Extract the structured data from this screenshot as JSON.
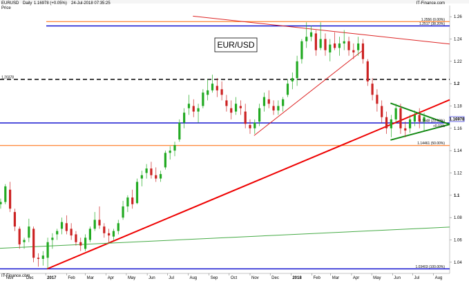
{
  "header": {
    "symbol": "EURUSD",
    "period": "Daily",
    "quote": "1.16978 (+0.05%)",
    "datetime": "24-Jul-2018 07:35:25",
    "source": "IT-Finance.com",
    "price_label": "Price"
  },
  "footer_source": "IT-Finance.com",
  "chart_data": {
    "type": "candlestick",
    "title": "EUR/USD",
    "ylim": [
      1.03,
      1.27
    ],
    "y_ticks": [
      {
        "value": 1.26,
        "label": "1.26",
        "bold": false
      },
      {
        "value": 1.24,
        "label": "1.24",
        "bold": false
      },
      {
        "value": 1.22,
        "label": "1.22",
        "bold": false
      },
      {
        "value": 1.2,
        "label": "1.2",
        "bold": true
      },
      {
        "value": 1.18,
        "label": "1.18",
        "bold": false
      },
      {
        "value": 1.16,
        "label": "1.16",
        "bold": false
      },
      {
        "value": 1.14,
        "label": "1.14",
        "bold": false
      },
      {
        "value": 1.12,
        "label": "1.12",
        "bold": false
      },
      {
        "value": 1.1,
        "label": "1.1",
        "bold": true
      },
      {
        "value": 1.08,
        "label": "1.08",
        "bold": false
      },
      {
        "value": 1.06,
        "label": "1.06",
        "bold": false
      },
      {
        "value": 1.04,
        "label": "1.04",
        "bold": false
      }
    ],
    "x_labels": [
      {
        "date": "2016-11-01",
        "label": "Nov",
        "bold": false
      },
      {
        "date": "2016-12-01",
        "label": "Dec",
        "bold": false
      },
      {
        "date": "2017-01-01",
        "label": "2017",
        "bold": true
      },
      {
        "date": "2017-02-01",
        "label": "Feb",
        "bold": false
      },
      {
        "date": "2017-03-01",
        "label": "Mar",
        "bold": false
      },
      {
        "date": "2017-04-01",
        "label": "Apr",
        "bold": false
      },
      {
        "date": "2017-05-01",
        "label": "May",
        "bold": false
      },
      {
        "date": "2017-06-01",
        "label": "Jun",
        "bold": false
      },
      {
        "date": "2017-07-01",
        "label": "Jul",
        "bold": false
      },
      {
        "date": "2017-08-01",
        "label": "Aug",
        "bold": false
      },
      {
        "date": "2017-09-01",
        "label": "Sep",
        "bold": false
      },
      {
        "date": "2017-10-01",
        "label": "Oct",
        "bold": false
      },
      {
        "date": "2017-11-01",
        "label": "Nov",
        "bold": false
      },
      {
        "date": "2017-12-01",
        "label": "Dec",
        "bold": false
      },
      {
        "date": "2018-01-01",
        "label": "2018",
        "bold": true
      },
      {
        "date": "2018-02-01",
        "label": "Feb",
        "bold": false
      },
      {
        "date": "2018-03-01",
        "label": "Mar",
        "bold": false
      },
      {
        "date": "2018-04-01",
        "label": "Apr",
        "bold": false
      },
      {
        "date": "2018-05-01",
        "label": "May",
        "bold": false
      },
      {
        "date": "2018-06-01",
        "label": "Jun",
        "bold": false
      },
      {
        "date": "2018-07-01",
        "label": "Jul",
        "bold": false
      },
      {
        "date": "2018-08-01",
        "label": "Aug",
        "bold": false
      }
    ],
    "x_range": [
      "2016-10-25",
      "2018-08-25"
    ],
    "current_price": {
      "value": 1.16978,
      "label": "1.16978"
    },
    "annotations": [
      {
        "text": "1.2556 (0.00%)",
        "price": 1.2556
      },
      {
        "text": "1.2517 (38.20%)",
        "price": 1.2517
      },
      {
        "text": "1.20378",
        "price": 1.20378
      },
      {
        "text": "1.1648 (23.60%)",
        "price": 1.1648
      },
      {
        "text": "+0.01%",
        "price": 1.1603
      },
      {
        "text": "1.14461 (50.00%)",
        "price": 1.14461
      },
      {
        "text": "1.03403 (100.00%)",
        "price": 1.03403
      }
    ],
    "horizontal_lines": [
      {
        "price": 1.2556,
        "color": "#ff6600",
        "style": "solid"
      },
      {
        "price": 1.2517,
        "color": "#0000cc",
        "style": "solid"
      },
      {
        "price": 1.20378,
        "color": "#000000",
        "style": "dashed"
      },
      {
        "price": 1.1648,
        "color": "#0000cc",
        "style": "solid"
      },
      {
        "price": 1.14461,
        "color": "#ff6600",
        "style": "solid"
      },
      {
        "price": 1.03403,
        "color": "#0000cc",
        "style": "solid"
      }
    ],
    "trend_lines": [
      {
        "from": [
          "2017-01-03",
          1.03403
        ],
        "to": [
          "2018-08-25",
          1.1855
        ],
        "color": "#ee0000"
      },
      {
        "from": [
          "2017-08-08",
          1.2605
        ],
        "to": [
          "2018-08-25",
          1.2355
        ],
        "color": "#dd2222"
      },
      {
        "from": [
          "2017-11-07",
          1.1535
        ],
        "to": [
          "2018-04-17",
          1.2295
        ],
        "color": "#dd2222"
      },
      {
        "from": [
          "2016-10-25",
          1.0525
        ],
        "to": [
          "2018-08-25",
          1.0715
        ],
        "color": "#44aa44"
      },
      {
        "from": [
          "2018-05-29",
          1.1825
        ],
        "to": [
          "2018-08-25",
          1.1635
        ],
        "color": "#118811"
      },
      {
        "from": [
          "2018-05-29",
          1.1495
        ],
        "to": [
          "2018-08-25",
          1.1635
        ],
        "color": "#118811"
      }
    ],
    "candles": [
      [
        "2016-10-26",
        1.092,
        1.097,
        1.088,
        1.094
      ],
      [
        "2016-11-02",
        1.094,
        1.11,
        1.092,
        1.108
      ],
      [
        "2016-11-09",
        1.105,
        1.112,
        1.085,
        1.088
      ],
      [
        "2016-11-16",
        1.085,
        1.088,
        1.068,
        1.072
      ],
      [
        "2016-11-23",
        1.07,
        1.072,
        1.052,
        1.056
      ],
      [
        "2016-11-30",
        1.058,
        1.062,
        1.052,
        1.06
      ],
      [
        "2016-12-07",
        1.062,
        1.079,
        1.058,
        1.072
      ],
      [
        "2016-12-14",
        1.07,
        1.072,
        1.04,
        1.044
      ],
      [
        "2016-12-21",
        1.044,
        1.048,
        1.036,
        1.043
      ],
      [
        "2016-12-28",
        1.043,
        1.05,
        1.037,
        1.046
      ],
      [
        "2017-01-04",
        1.044,
        1.062,
        1.034,
        1.058
      ],
      [
        "2017-01-11",
        1.06,
        1.066,
        1.052,
        1.062
      ],
      [
        "2017-01-18",
        1.065,
        1.07,
        1.06,
        1.068
      ],
      [
        "2017-01-25",
        1.07,
        1.08,
        1.065,
        1.076
      ],
      [
        "2017-02-01",
        1.075,
        1.082,
        1.065,
        1.068
      ],
      [
        "2017-02-08",
        1.07,
        1.075,
        1.06,
        1.064
      ],
      [
        "2017-02-15",
        1.065,
        1.068,
        1.055,
        1.058
      ],
      [
        "2017-02-22",
        1.058,
        1.062,
        1.05,
        1.055
      ],
      [
        "2017-03-01",
        1.052,
        1.065,
        1.05,
        1.062
      ],
      [
        "2017-03-08",
        1.06,
        1.072,
        1.058,
        1.07
      ],
      [
        "2017-03-15",
        1.07,
        1.085,
        1.068,
        1.078
      ],
      [
        "2017-03-22",
        1.078,
        1.09,
        1.07,
        1.073
      ],
      [
        "2017-03-29",
        1.072,
        1.075,
        1.062,
        1.066
      ],
      [
        "2017-04-05",
        1.066,
        1.07,
        1.058,
        1.064
      ],
      [
        "2017-04-12",
        1.063,
        1.07,
        1.06,
        1.068
      ],
      [
        "2017-04-19",
        1.068,
        1.078,
        1.065,
        1.075
      ],
      [
        "2017-04-26",
        1.08,
        1.095,
        1.078,
        1.09
      ],
      [
        "2017-05-03",
        1.09,
        1.1,
        1.085,
        1.098
      ],
      [
        "2017-05-10",
        1.098,
        1.105,
        1.088,
        1.092
      ],
      [
        "2017-05-17",
        1.093,
        1.115,
        1.092,
        1.112
      ],
      [
        "2017-05-24",
        1.115,
        1.122,
        1.108,
        1.118
      ],
      [
        "2017-05-31",
        1.12,
        1.128,
        1.115,
        1.124
      ],
      [
        "2017-06-07",
        1.124,
        1.13,
        1.115,
        1.118
      ],
      [
        "2017-06-14",
        1.118,
        1.125,
        1.112,
        1.115
      ],
      [
        "2017-06-21",
        1.115,
        1.122,
        1.112,
        1.119
      ],
      [
        "2017-06-28",
        1.125,
        1.14,
        1.123,
        1.138
      ],
      [
        "2017-07-05",
        1.138,
        1.144,
        1.132,
        1.14
      ],
      [
        "2017-07-12",
        1.14,
        1.148,
        1.135,
        1.145
      ],
      [
        "2017-07-19",
        1.15,
        1.168,
        1.148,
        1.165
      ],
      [
        "2017-07-26",
        1.165,
        1.178,
        1.16,
        1.174
      ],
      [
        "2017-08-02",
        1.178,
        1.19,
        1.172,
        1.182
      ],
      [
        "2017-08-09",
        1.18,
        1.186,
        1.17,
        1.175
      ],
      [
        "2017-08-16",
        1.175,
        1.182,
        1.165,
        1.178
      ],
      [
        "2017-08-23",
        1.18,
        1.195,
        1.178,
        1.192
      ],
      [
        "2017-08-30",
        1.19,
        1.204,
        1.185,
        1.194
      ],
      [
        "2017-09-06",
        1.194,
        1.208,
        1.192,
        1.2
      ],
      [
        "2017-09-13",
        1.198,
        1.205,
        1.188,
        1.194
      ],
      [
        "2017-09-20",
        1.195,
        1.202,
        1.185,
        1.19
      ],
      [
        "2017-09-27",
        1.185,
        1.19,
        1.175,
        1.18
      ],
      [
        "2017-10-04",
        1.178,
        1.185,
        1.168,
        1.174
      ],
      [
        "2017-10-11",
        1.175,
        1.188,
        1.172,
        1.182
      ],
      [
        "2017-10-18",
        1.18,
        1.185,
        1.172,
        1.178
      ],
      [
        "2017-10-25",
        1.175,
        1.182,
        1.16,
        1.164
      ],
      [
        "2017-11-01",
        1.163,
        1.168,
        1.155,
        1.16
      ],
      [
        "2017-11-08",
        1.16,
        1.168,
        1.155,
        1.165
      ],
      [
        "2017-11-15",
        1.166,
        1.182,
        1.162,
        1.178
      ],
      [
        "2017-11-22",
        1.18,
        1.192,
        1.175,
        1.188
      ],
      [
        "2017-11-29",
        1.186,
        1.194,
        1.178,
        1.182
      ],
      [
        "2017-12-06",
        1.18,
        1.185,
        1.172,
        1.176
      ],
      [
        "2017-12-13",
        1.176,
        1.185,
        1.172,
        1.18
      ],
      [
        "2017-12-20",
        1.18,
        1.188,
        1.175,
        1.186
      ],
      [
        "2017-12-27",
        1.19,
        1.204,
        1.188,
        1.2
      ],
      [
        "2018-01-03",
        1.202,
        1.21,
        1.195,
        1.205
      ],
      [
        "2018-01-10",
        1.205,
        1.225,
        1.198,
        1.22
      ],
      [
        "2018-01-17",
        1.222,
        1.24,
        1.218,
        1.238
      ],
      [
        "2018-01-24",
        1.238,
        1.255,
        1.232,
        1.242
      ],
      [
        "2018-01-31",
        1.242,
        1.252,
        1.238,
        1.246
      ],
      [
        "2018-02-07",
        1.245,
        1.248,
        1.225,
        1.23
      ],
      [
        "2018-02-14",
        1.232,
        1.255,
        1.23,
        1.24
      ],
      [
        "2018-02-21",
        1.24,
        1.245,
        1.225,
        1.23
      ],
      [
        "2018-02-28",
        1.228,
        1.24,
        1.22,
        1.235
      ],
      [
        "2018-03-07",
        1.236,
        1.246,
        1.23,
        1.232
      ],
      [
        "2018-03-14",
        1.232,
        1.242,
        1.225,
        1.236
      ],
      [
        "2018-03-21",
        1.236,
        1.248,
        1.23,
        1.238
      ],
      [
        "2018-03-28",
        1.238,
        1.242,
        1.225,
        1.23
      ],
      [
        "2018-04-04",
        1.23,
        1.236,
        1.222,
        1.228
      ],
      [
        "2018-04-11",
        1.23,
        1.242,
        1.225,
        1.236
      ],
      [
        "2018-04-18",
        1.236,
        1.24,
        1.218,
        1.222
      ],
      [
        "2018-04-25",
        1.22,
        1.222,
        1.198,
        1.202
      ],
      [
        "2018-05-02",
        1.2,
        1.205,
        1.185,
        1.19
      ],
      [
        "2018-05-09",
        1.19,
        1.195,
        1.175,
        1.182
      ],
      [
        "2018-05-16",
        1.18,
        1.185,
        1.165,
        1.17
      ],
      [
        "2018-05-23",
        1.17,
        1.175,
        1.155,
        1.16
      ],
      [
        "2018-05-30",
        1.16,
        1.172,
        1.152,
        1.168
      ],
      [
        "2018-06-06",
        1.168,
        1.182,
        1.165,
        1.178
      ],
      [
        "2018-06-13",
        1.178,
        1.182,
        1.155,
        1.16
      ],
      [
        "2018-06-20",
        1.16,
        1.166,
        1.152,
        1.158
      ],
      [
        "2018-06-27",
        1.16,
        1.172,
        1.156,
        1.168
      ],
      [
        "2018-07-04",
        1.166,
        1.176,
        1.162,
        1.172
      ],
      [
        "2018-07-11",
        1.172,
        1.178,
        1.16,
        1.166
      ],
      [
        "2018-07-18",
        1.166,
        1.174,
        1.158,
        1.17
      ]
    ]
  }
}
